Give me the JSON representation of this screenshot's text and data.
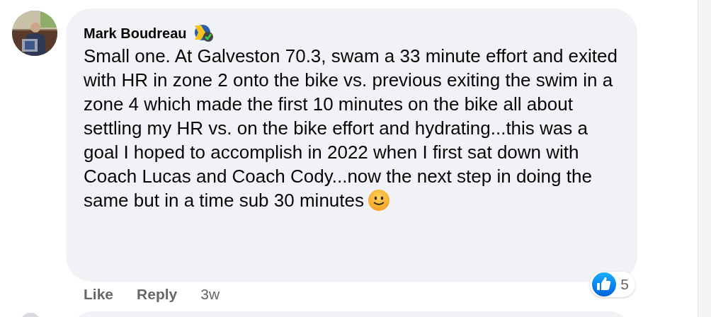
{
  "comment": {
    "author": "Mark Boudreau",
    "text": "Small one. At Galveston 70.3, swam a 33 minute effort and exited with HR in zone 2 onto the bike vs. previous exiting the swim in a zone 4 which made the first 10 minutes on the bike all about settling my HR vs. on the bike effort and hydrating...this was a goal I hoped to accomplish in 2022 when I first sat down with Coach Lucas and Coach Cody...now the next step in doing the same but in a time sub 30 minutes",
    "reactions": {
      "count": "5"
    },
    "actions": [
      {
        "label": "Like"
      },
      {
        "label": "Reply"
      }
    ],
    "time": "3w"
  }
}
